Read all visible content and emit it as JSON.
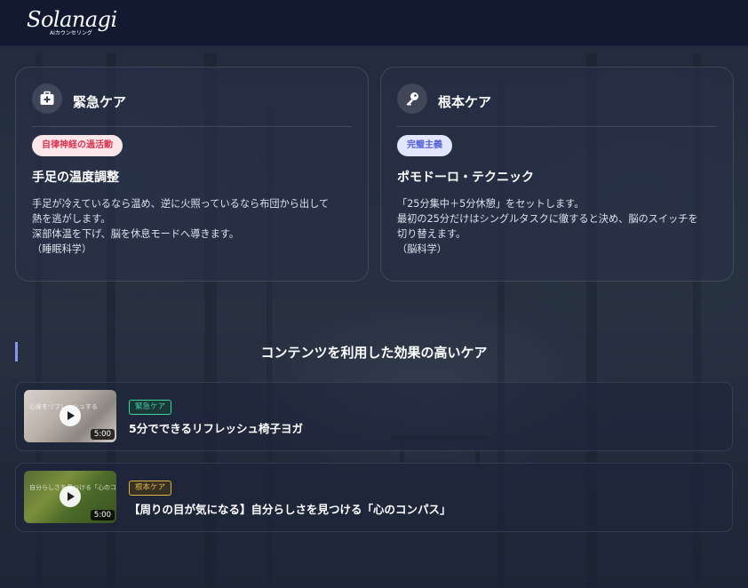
{
  "header": {
    "logo_script": "Solanagi",
    "logo_sub": "AIカウンセリング"
  },
  "cards": [
    {
      "icon": "first-aid-kit-icon",
      "title": "緊急ケア",
      "pill": "自律神経の過活動",
      "pill_color": "#d8344f",
      "subtitle": "手足の温度調整",
      "body_lines": [
        "手足が冷えているなら温め、逆に火照っているなら布団から出して",
        "熱を逃がします。",
        "深部体温を下げ、脳を休息モードへ導きます。",
        "（睡眠科学）"
      ]
    },
    {
      "icon": "key-icon",
      "title": "根本ケア",
      "pill": "完璧主義",
      "pill_color": "#5560d6",
      "subtitle": "ポモドーロ・テクニック",
      "body_lines": [
        "「25分集中＋5分休憩」をセットします。",
        "最初の25分だけはシングルタスクに徹すると決め、脳のスイッチを",
        "切り替えます。",
        "（脳科学）"
      ]
    }
  ],
  "section": {
    "title": "コンテンツを利用した効果の高いケア",
    "accent": "#8b93ee"
  },
  "videos": [
    {
      "tag": "緊急ケア",
      "tag_color": "#3fd39b",
      "title": "5分でできるリフレッシュ椅子ヨガ",
      "duration": "5:00",
      "thumb_text": "心身をリフレッシュする",
      "thumb_icon": "play-icon"
    },
    {
      "tag": "根本ケア",
      "tag_color": "#e2b23f",
      "title": "【周りの目が気になる】自分らしさを見つける「心のコンパス」",
      "duration": "5:00",
      "thumb_text": "自分らしさを見つける「心のコンパス」",
      "thumb_icon": "play-icon"
    }
  ]
}
